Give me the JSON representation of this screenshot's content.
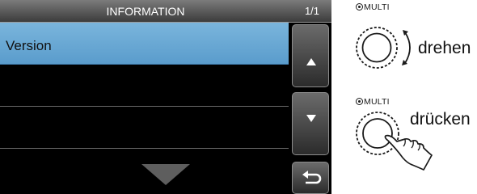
{
  "screen": {
    "title": "INFORMATION",
    "page": "1/1",
    "rows": [
      {
        "label": "Version",
        "selected": true
      },
      {
        "label": "",
        "selected": false
      },
      {
        "label": "",
        "selected": false
      }
    ],
    "buttons": {
      "up": "up-arrow-icon",
      "down": "down-arrow-icon",
      "back": "return-icon"
    },
    "colors": {
      "selected_row": "#6aa8d6",
      "background": "#000000"
    }
  },
  "instructions": {
    "rotate": {
      "knob_label": "MULTI",
      "action": "drehen"
    },
    "press": {
      "knob_label": "MULTI",
      "action": "drücken"
    }
  }
}
